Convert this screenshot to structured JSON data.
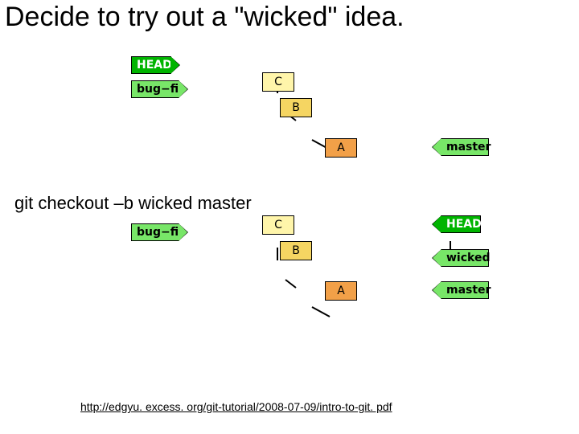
{
  "title": "Decide to try out a \"wicked\" idea.",
  "command": "git checkout –b wicked master",
  "footer_link": "http://edgyu. excess. org/git-tutorial/2008-07-09/intro-to-git. pdf",
  "labels": {
    "head": "HEAD",
    "bugfix": "bug−fi",
    "master": "master",
    "wicked": "wicked"
  },
  "commits": {
    "c": "C",
    "b": "B",
    "a": "A"
  },
  "chart_data": [
    {
      "type": "diagram",
      "title": "before checkout",
      "commits": [
        "C",
        "B",
        "A"
      ],
      "edges": [
        [
          "C",
          "B"
        ],
        [
          "B",
          "A"
        ]
      ],
      "branches": {
        "bug-fi": "C",
        "master": "A"
      },
      "head": "bug-fi"
    },
    {
      "type": "diagram",
      "title": "after checkout",
      "commits": [
        "C",
        "B",
        "A"
      ],
      "edges": [
        [
          "C",
          "B"
        ],
        [
          "B",
          "A"
        ]
      ],
      "branches": {
        "bug-fi": "C",
        "master": "A",
        "wicked": "A"
      },
      "head": "wicked"
    }
  ]
}
